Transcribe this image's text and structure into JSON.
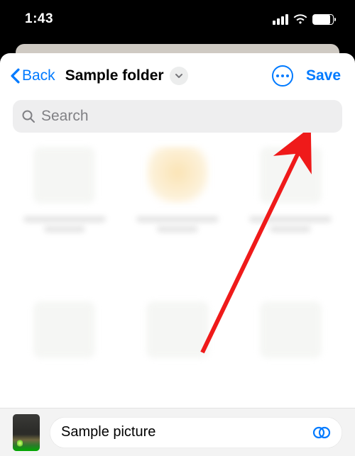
{
  "status": {
    "time": "1:43"
  },
  "header": {
    "back_label": "Back",
    "title": "Sample folder",
    "save_label": "Save"
  },
  "search": {
    "placeholder": "Search"
  },
  "bottom": {
    "filename": "Sample picture"
  },
  "colors": {
    "accent": "#007aff"
  }
}
